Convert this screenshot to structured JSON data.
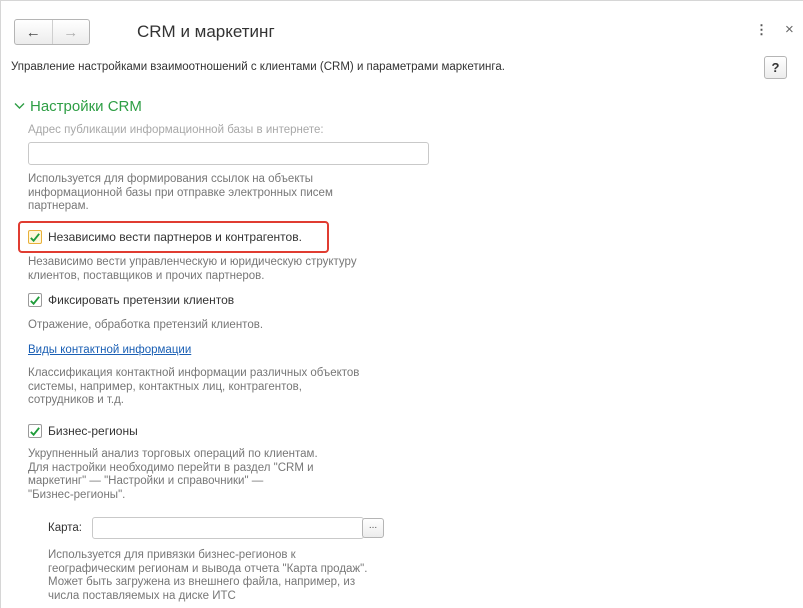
{
  "window": {
    "title": "CRM и маркетинг",
    "description": "Управление настройками взаимоотношений с клиентами (CRM) и параметрами маркетинга.",
    "help_label": "?",
    "back_glyph": "←",
    "forward_glyph": "→",
    "menu_glyph": "⋮",
    "close_glyph": "×"
  },
  "crm_group": {
    "title": "Настройки CRM",
    "address_label": "Адрес публикации информационной базы в интернете:",
    "address_value": "",
    "address_help": "Используется для формирования ссылок на объекты\nинформационной базы при отправке электронных писем\nпартнерам.",
    "independent_partners": {
      "label": "Независимо вести партнеров и контрагентов.",
      "checked": true,
      "help": "Независимо вести управленческую и юридическую структуру\nклиентов, поставщиков и прочих партнеров."
    },
    "claims": {
      "label": "Фиксировать претензии клиентов",
      "checked": true,
      "help": "Отражение, обработка претензий клиентов."
    },
    "contact_info": {
      "link": "Виды контактной информации",
      "help": "Классификация контактной информации различных объектов\nсистемы, например, контактных лиц, контрагентов,\nсотрудников и т.д."
    },
    "business_regions": {
      "label": "Бизнес-регионы",
      "checked": true,
      "help": "Укрупненный анализ торговых операций по клиентам.\nДля настройки необходимо перейти в раздел \"CRM и\nмаркетинг\" — \"Настройки и справочники\" —\n\"Бизнес-регионы\"."
    },
    "map": {
      "label": "Карта:",
      "value": "",
      "select_glyph": "...",
      "help": "Используется для привязки бизнес-регионов к\nгеографическим регионам и вывода отчета \"Карта продаж\".\nМожет быть загружена из внешнего файла, например, из\nчисла поставляемых на диске ИТС"
    }
  },
  "colors": {
    "accent_green": "#2e9e45",
    "link_blue": "#1a5fb4",
    "highlight_red": "#e03c31",
    "check_green": "#1f9c3a"
  }
}
